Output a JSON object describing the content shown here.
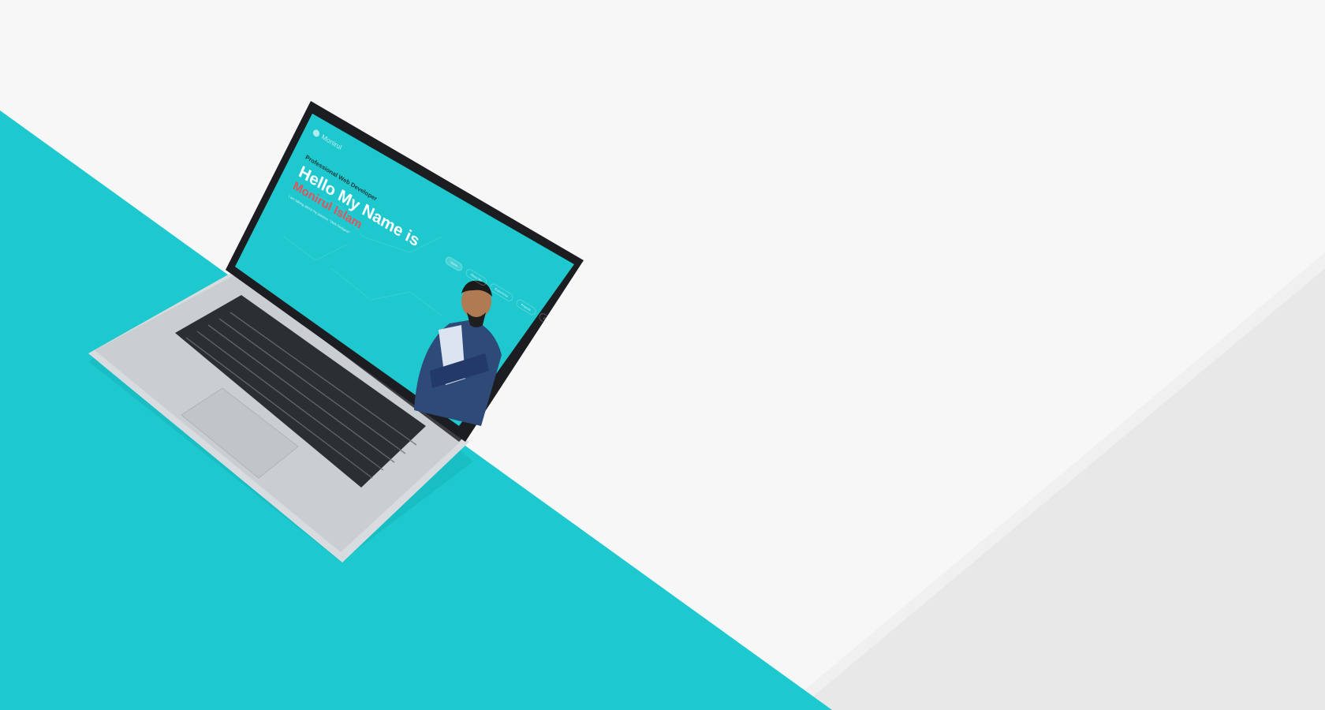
{
  "scene": {
    "colors": {
      "background": "#f7f7f7",
      "accent": "#1dc9cf",
      "right_panel": "#e9e8e9",
      "name_highlight": "#e4525a"
    }
  },
  "laptop_screen": {
    "logo_text": "Monirul",
    "subtitle": "Professional Web Developer",
    "headline": "Hello My Name is",
    "name": "Monirul Islam",
    "tagline": "I am talking about my passion, \"Web Designer\"",
    "nav": [
      {
        "label": "Home",
        "active": true
      },
      {
        "label": "About Me",
        "active": false
      },
      {
        "label": "Experience",
        "active": false
      },
      {
        "label": "Projects",
        "active": false
      },
      {
        "label": "Contact Me",
        "active": false
      }
    ],
    "portrait_icon": "person-portrait-icon"
  }
}
